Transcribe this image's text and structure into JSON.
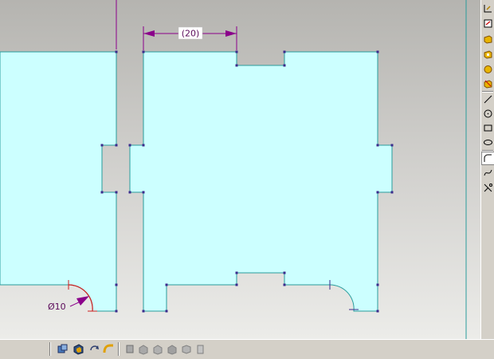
{
  "viewport": {
    "dimension_horizontal": "(20)",
    "dimension_diameter": "Ø10"
  },
  "toolbar_right": {
    "items": [
      "smart-dimension-icon",
      "sketch-icon",
      "extruded-boss-icon",
      "extruded-cut-icon",
      "revolve-icon",
      "sweep-icon",
      "line-icon",
      "circle-icon",
      "rectangle-icon",
      "ellipse-icon",
      "fillet-icon",
      "spline-icon",
      "trim-icon"
    ]
  },
  "toolbar_bottom": {
    "items": [
      "view-orientation-icon",
      "shaded-icon",
      "rotate-view-icon",
      "pan-view-icon",
      "front-view-icon",
      "top-view-icon",
      "right-view-icon",
      "isometric-view-icon",
      "normal-to-icon",
      "section-view-icon"
    ]
  },
  "colors": {
    "sketch_fill": "#ccffff",
    "sketch_edge": "#2a9c9c",
    "dimension": "#8b008b",
    "vertex": "#3b2a8c",
    "arc_selected": "#cc2020"
  }
}
